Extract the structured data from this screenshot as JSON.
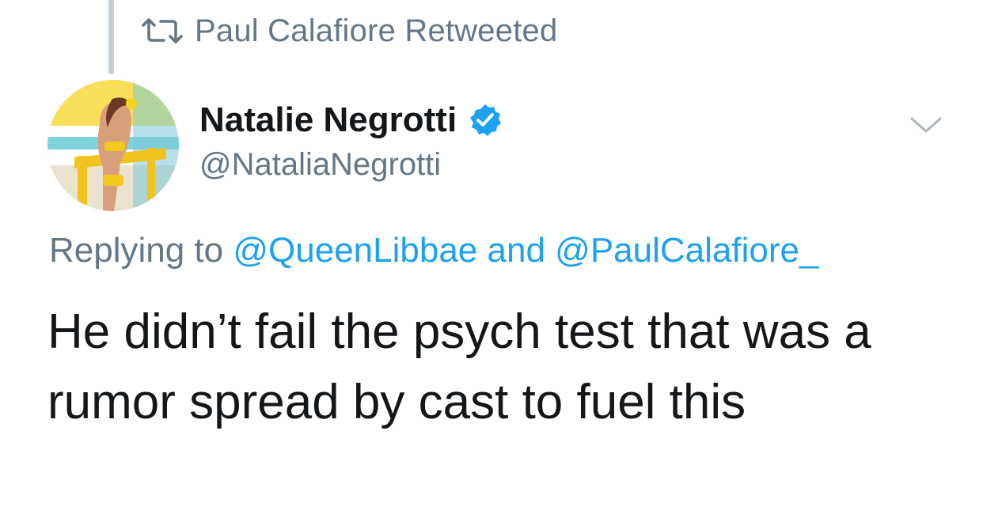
{
  "retweet": {
    "label": "Paul Calafiore Retweeted",
    "icon": "retweet-icon"
  },
  "author": {
    "display_name": "Natalie Negrotti",
    "handle": "@NataliaNegrotti",
    "verified": true,
    "verified_icon": "verified-badge-icon",
    "avatar": "profile-photo"
  },
  "menu": {
    "icon": "chevron-down-icon"
  },
  "reply_context": {
    "prefix": "Replying to",
    "mention_1": "@QueenLibbae",
    "conjunction": "and",
    "mention_2": "@PaulCalafiore_"
  },
  "tweet": {
    "text": "He didn’t fail the psych test that was a\nrumor spread by cast to fuel this"
  },
  "colors": {
    "primary_text": "#14171a",
    "secondary_text": "#657786",
    "link": "#1da1f2",
    "verified": "#1da1f2",
    "thread_line": "#c4cfd6"
  }
}
